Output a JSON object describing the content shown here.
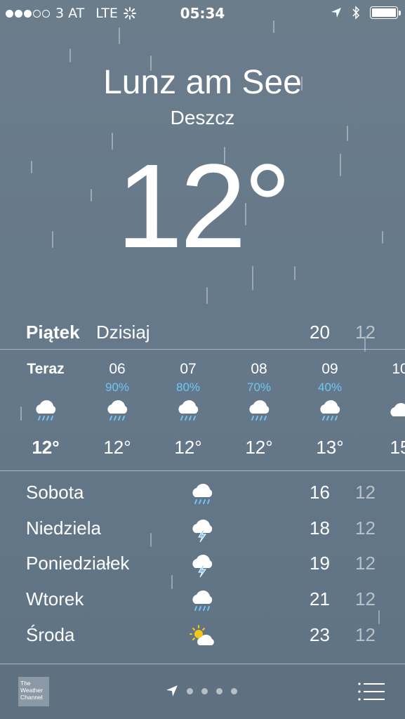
{
  "status_bar": {
    "carrier": "3 AT",
    "network": "LTE",
    "time": "05:34",
    "signal_bars_filled": 3,
    "signal_bars_total": 5
  },
  "header": {
    "city": "Lunz am See",
    "condition": "Deszcz",
    "temperature": "12°"
  },
  "today": {
    "day": "Piątek",
    "label": "Dzisiaj",
    "high": "20",
    "low": "12"
  },
  "hourly": [
    {
      "hour": "Teraz",
      "precip": "",
      "temp": "12°",
      "icon": "rain-cloud-icon"
    },
    {
      "hour": "06",
      "precip": "90%",
      "temp": "12°",
      "icon": "rain-cloud-icon"
    },
    {
      "hour": "07",
      "precip": "80%",
      "temp": "12°",
      "icon": "rain-cloud-icon"
    },
    {
      "hour": "08",
      "precip": "70%",
      "temp": "12°",
      "icon": "rain-cloud-icon"
    },
    {
      "hour": "09",
      "precip": "40%",
      "temp": "13°",
      "icon": "rain-cloud-icon"
    },
    {
      "hour": "10",
      "precip": "",
      "temp": "15",
      "icon": "cloud-icon"
    }
  ],
  "daily": [
    {
      "day": "Sobota",
      "icon": "rain-cloud-icon",
      "high": "16",
      "low": "12"
    },
    {
      "day": "Niedziela",
      "icon": "thunderstorm-icon",
      "high": "18",
      "low": "12"
    },
    {
      "day": "Poniedziałek",
      "icon": "thunderstorm-icon",
      "high": "19",
      "low": "12"
    },
    {
      "day": "Wtorek",
      "icon": "rain-cloud-icon",
      "high": "21",
      "low": "12"
    },
    {
      "day": "Środa",
      "icon": "partly-sunny-icon",
      "high": "23",
      "low": "12"
    }
  ],
  "bottom_bar": {
    "brand_logo": "The Weather Channel",
    "page_dots": 4
  },
  "colors": {
    "background": "#66798a",
    "precip_blue": "#6fc6f5",
    "sun_yellow": "#f5c518"
  }
}
